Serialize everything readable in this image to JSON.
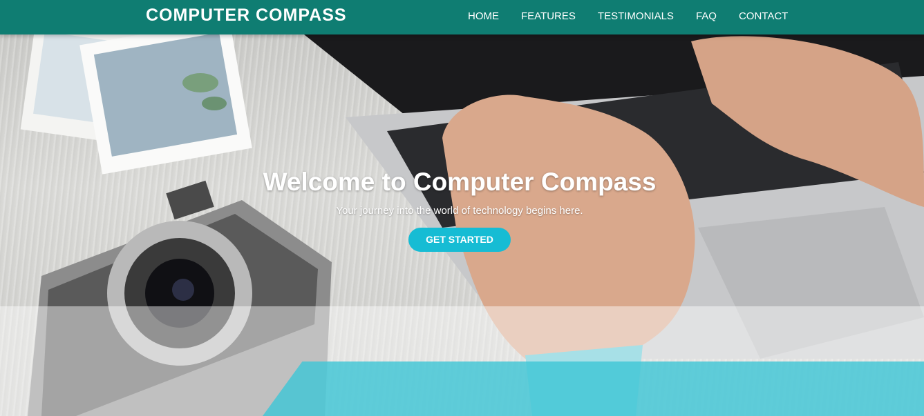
{
  "navbar": {
    "brand": "COMPUTER COMPASS",
    "links": [
      "HOME",
      "FEATURES",
      "TESTIMONIALS",
      "FAQ",
      "CONTACT"
    ]
  },
  "hero": {
    "title": "Welcome to Computer Compass",
    "subtitle": "Your journey into the world of technology begins here.",
    "cta_label": "GET STARTED"
  },
  "colors": {
    "navbar": "#0f7d72",
    "cta": "#16bcd4",
    "teal_band": "#40c6d6"
  }
}
